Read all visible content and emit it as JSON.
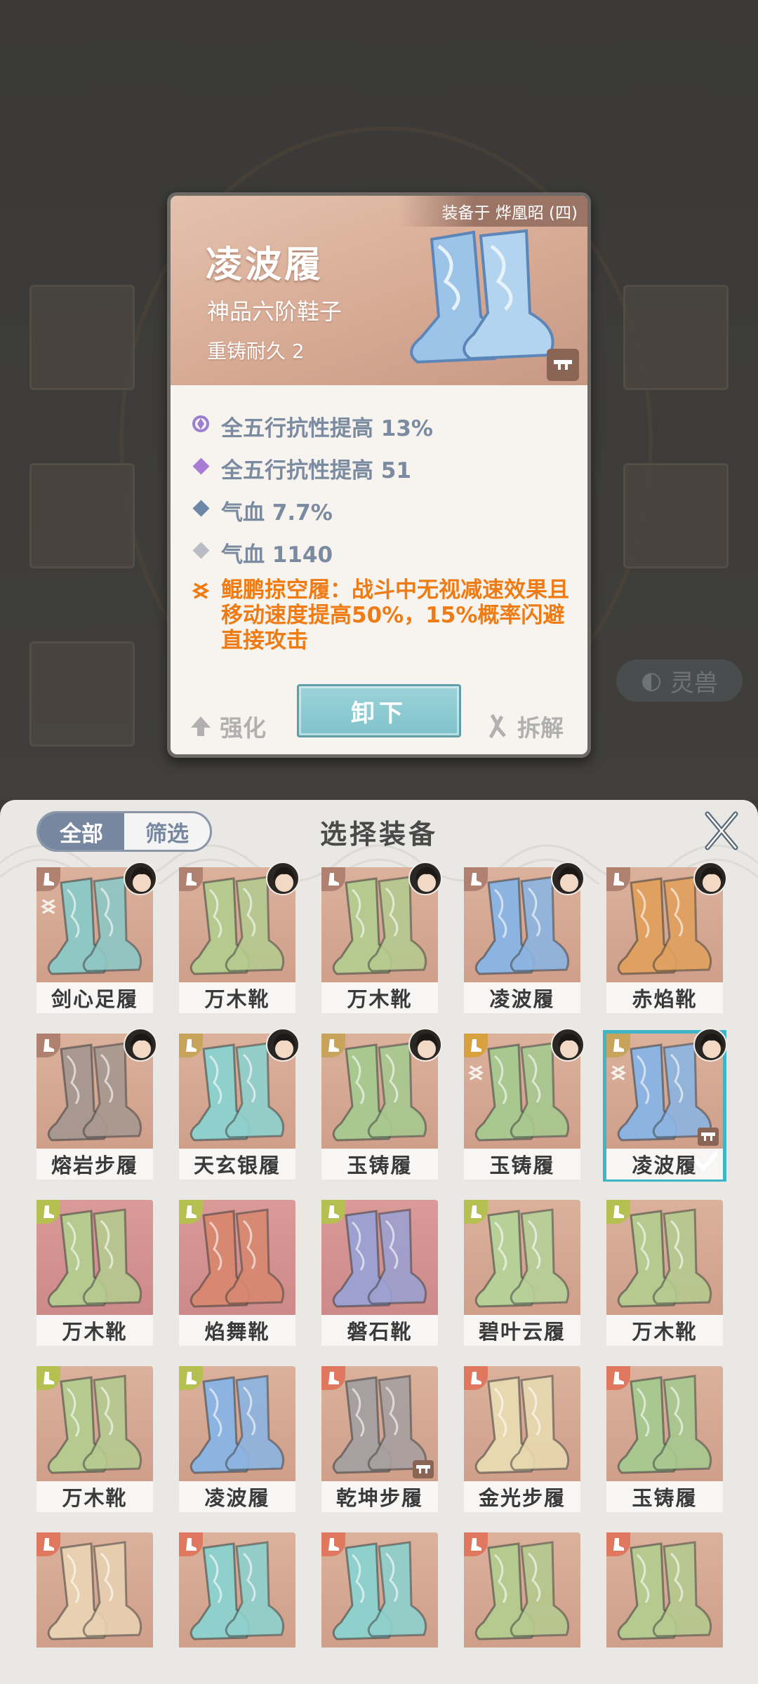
{
  "background": {
    "side_tab_label": "灵兽"
  },
  "detail_card": {
    "equipped_on": "装备于 烨凰昭 (四)",
    "name": "凌波履",
    "type": "神品六阶鞋子",
    "durability": "重铸耐久 2",
    "stats": [
      {
        "text": "全五行抗性提高 13%",
        "icon": "aura-icon",
        "color": "#9b7fd0"
      },
      {
        "text": "全五行抗性提高 51",
        "icon": "diamond-icon",
        "color": "#a77bd6"
      },
      {
        "text": "气血 7.7%",
        "icon": "diamond-icon",
        "color": "#6d87a6"
      },
      {
        "text": "气血 1140",
        "icon": "diamond-icon",
        "color": "#b9bcc2"
      }
    ],
    "special_effect": "鲲鹏掠空履：战斗中无视减速效果且移动速度提高50%，15%概率闪避直接攻击",
    "unequip_label": "卸下",
    "enhance_label": "强化",
    "dismantle_label": "拆解"
  },
  "panel": {
    "tabs": [
      "全部",
      "筛选"
    ],
    "active_tab": "全部",
    "title": "选择装备",
    "items": [
      {
        "name": "剑心足履",
        "tint": "peach",
        "slot_color": "#b08070",
        "avatar": true,
        "aura": true,
        "boot": "#8fc7c4"
      },
      {
        "name": "万木靴",
        "tint": "peach",
        "slot_color": "#b08070",
        "avatar": true,
        "boot": "#b6c98f"
      },
      {
        "name": "万木靴",
        "tint": "peach",
        "slot_color": "#b08070",
        "avatar": true,
        "boot": "#b6c98f"
      },
      {
        "name": "凌波履",
        "tint": "peach",
        "slot_color": "#b08070",
        "avatar": true,
        "boot": "#8db4e0"
      },
      {
        "name": "赤焰靴",
        "tint": "peach",
        "slot_color": "#b08070",
        "avatar": true,
        "boot": "#e0a060"
      },
      {
        "name": "熔岩步履",
        "tint": "peach",
        "slot_color": "#b08070",
        "avatar": true,
        "boot": "#a89890"
      },
      {
        "name": "天玄银履",
        "tint": "peach",
        "slot_color": "#c7a35c",
        "avatar": true,
        "boot": "#8fd0cc"
      },
      {
        "name": "玉铸履",
        "tint": "peach",
        "slot_color": "#c7a35c",
        "avatar": true,
        "boot": "#a8c890"
      },
      {
        "name": "玉铸履",
        "tint": "peach",
        "slot_color": "#d9a040",
        "avatar": true,
        "aura": true,
        "boot": "#a8c890"
      },
      {
        "name": "凌波履",
        "tint": "peach",
        "slot_color": "#c7a35c",
        "avatar": true,
        "aura": true,
        "boot": "#8db4e0",
        "selected": true,
        "locked": true
      },
      {
        "name": "万木靴",
        "tint": "red",
        "slot_color": "#b6c050",
        "boot": "#b6c98f"
      },
      {
        "name": "焰舞靴",
        "tint": "red",
        "slot_color": "#b6c050",
        "boot": "#d88870"
      },
      {
        "name": "磐石靴",
        "tint": "red",
        "slot_color": "#b6c050",
        "boot": "#9ea0d0"
      },
      {
        "name": "碧叶云履",
        "tint": "peach",
        "slot_color": "#b6c050",
        "boot": "#b6d098"
      },
      {
        "name": "万木靴",
        "tint": "peach",
        "slot_color": "#b6c050",
        "boot": "#b6c98f"
      },
      {
        "name": "万木靴",
        "tint": "peach",
        "slot_color": "#b6c050",
        "boot": "#b6c98f"
      },
      {
        "name": "凌波履",
        "tint": "peach",
        "slot_color": "#b6c050",
        "boot": "#8db4e0"
      },
      {
        "name": "乾坤步履",
        "tint": "peach",
        "slot_color": "#e07860",
        "boot": "#a8a0a0",
        "locked": true
      },
      {
        "name": "金光步履",
        "tint": "peach",
        "slot_color": "#e07860",
        "boot": "#e8d8b0"
      },
      {
        "name": "玉铸履",
        "tint": "peach",
        "slot_color": "#e07860",
        "boot": "#a8c890"
      },
      {
        "name": "",
        "tint": "peach",
        "slot_color": "#e07860",
        "boot": "#e8d0b0"
      },
      {
        "name": "",
        "tint": "peach",
        "slot_color": "#e07860",
        "boot": "#8fd0cc"
      },
      {
        "name": "",
        "tint": "peach",
        "slot_color": "#e07860",
        "boot": "#8fd0cc"
      },
      {
        "name": "",
        "tint": "peach",
        "slot_color": "#e07860",
        "boot": "#b6c98f"
      },
      {
        "name": "",
        "tint": "peach",
        "slot_color": "#e07860",
        "boot": "#b6c98f"
      }
    ]
  }
}
